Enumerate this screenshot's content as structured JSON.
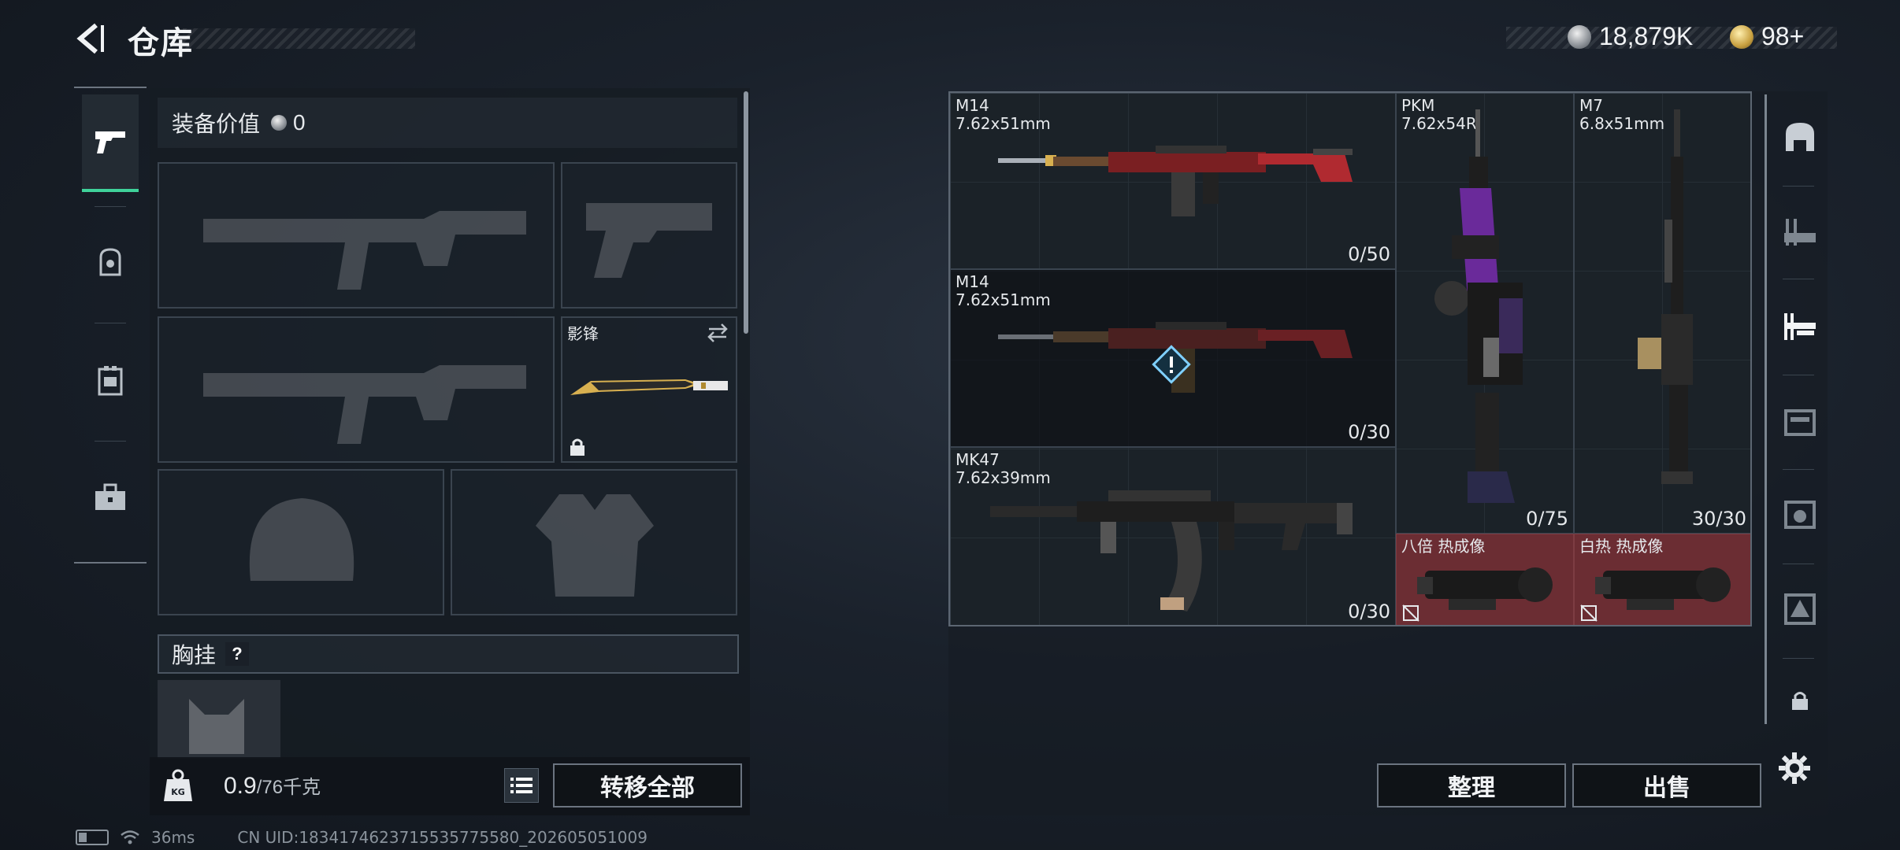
{
  "header": {
    "title": "仓库",
    "currencies": [
      {
        "icon": "silver-coin-icon",
        "value": "18,879K"
      },
      {
        "icon": "gold-coin-icon",
        "value": "98+"
      }
    ]
  },
  "categories": [
    {
      "icon": "pistol-icon",
      "active": true
    },
    {
      "icon": "helmet-icon",
      "active": false
    },
    {
      "icon": "vest-icon",
      "active": false
    },
    {
      "icon": "toolbox-icon",
      "active": false
    }
  ],
  "loadout": {
    "equip_value_label": "装备价值",
    "equip_value": "0",
    "melee_name": "影锋",
    "chest_rig_label": "胸挂",
    "help_glyph": "?",
    "weight_current": "0.9",
    "weight_capacity": "/76千克",
    "transfer_all_label": "转移全部"
  },
  "storage": {
    "items": [
      {
        "name": "M14",
        "caliber": "7.62x51mm",
        "count": "0/50"
      },
      {
        "name": "M14",
        "caliber": "7.62x51mm",
        "count": "0/30"
      },
      {
        "name": "MK47",
        "caliber": "7.62x39mm",
        "count": "0/30"
      },
      {
        "name": "PKM",
        "caliber": "7.62x54R",
        "count": "0/75"
      },
      {
        "name": "M7",
        "caliber": "6.8x51mm",
        "count": "30/30"
      },
      {
        "name": "八倍 热成像"
      },
      {
        "name": "白热 热成像"
      }
    ],
    "sort_label": "整理",
    "sell_label": "出售"
  },
  "right_bar": {
    "icons": [
      "hideout-icon",
      "weapon-bench-icon",
      "sniper-rack-icon",
      "storage-box-icon",
      "vest-rack-icon",
      "armor-rack-icon",
      "lock-icon",
      "settings-gear-icon"
    ]
  },
  "status_bar": {
    "ping": "36ms",
    "uid": "CN UID:1834174623715535775580_202605051009"
  },
  "colors": {
    "accent": "#3fd29a",
    "danger_slot": "#6b2d33"
  }
}
